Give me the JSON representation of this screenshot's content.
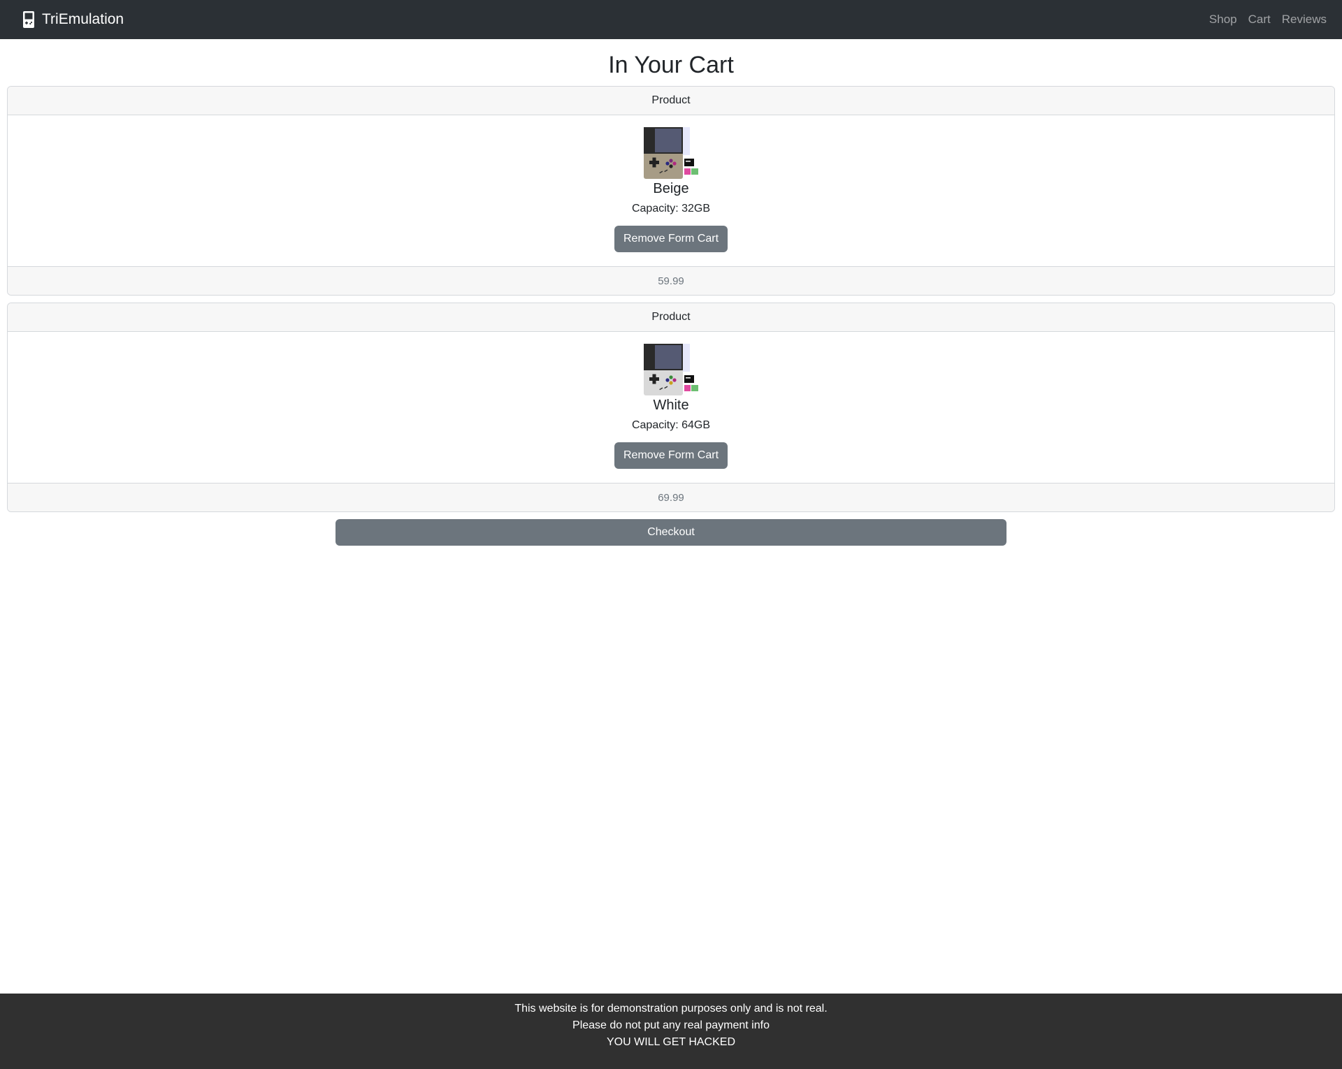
{
  "navbar": {
    "brand": "TriEmulation",
    "brand_icon": "handheld-console-icon",
    "links": [
      "Shop",
      "Cart",
      "Reviews"
    ]
  },
  "page": {
    "title": "In Your Cart"
  },
  "cart": {
    "items": [
      {
        "header": "Product",
        "name": "Beige",
        "capacity": "Capacity: 32GB",
        "remove_label": "Remove Form Cart",
        "price": "59.99",
        "console_color": "#a79c86"
      },
      {
        "header": "Product",
        "name": "White",
        "capacity": "Capacity: 64GB",
        "remove_label": "Remove Form Cart",
        "price": "69.99",
        "console_color": "#d9d9d9"
      }
    ],
    "checkout_label": "Checkout"
  },
  "footer": {
    "lines": [
      "This website is for demonstration purposes only and is not real.",
      "Please do not put any real payment info",
      "YOU WILL GET HACKED"
    ]
  },
  "colors": {
    "navbar_bg": "#2b3035",
    "button_secondary": "#6c757d",
    "footer_bg": "#303030"
  }
}
